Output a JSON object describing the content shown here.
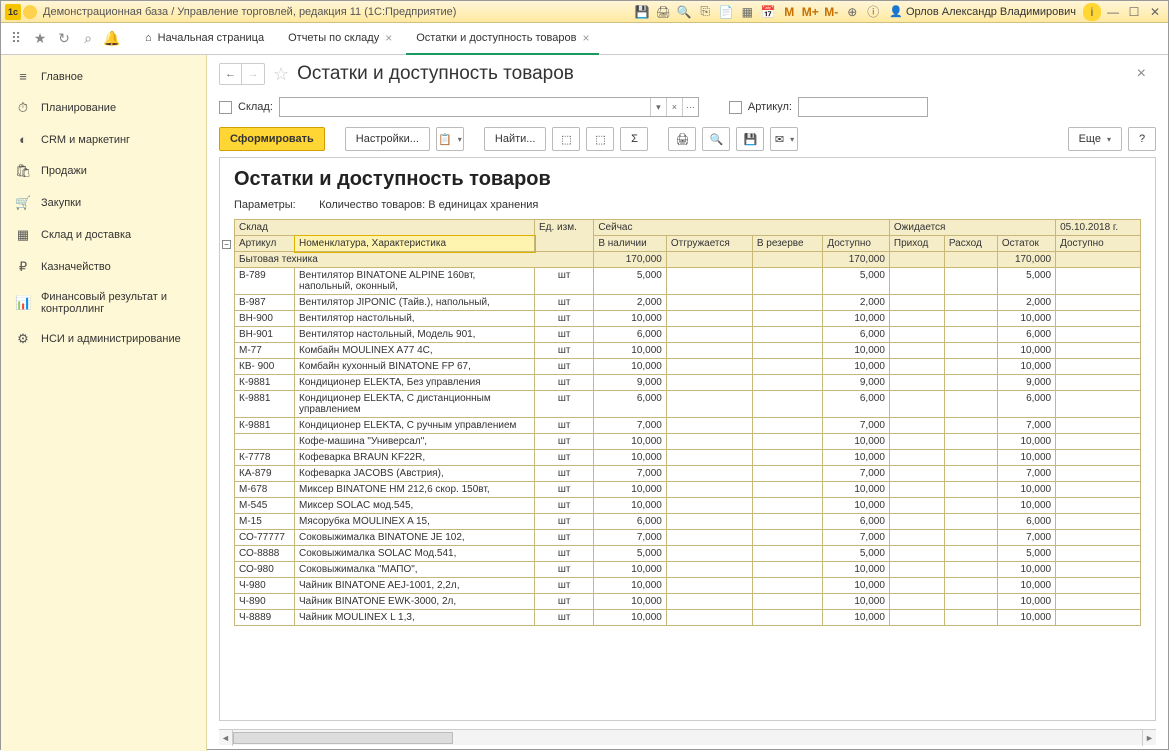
{
  "titlebar": {
    "title": "Демонстрационная база / Управление торговлей, редакция 11  (1С:Предприятие)",
    "user": "Орлов Александр Владимирович"
  },
  "tabs": {
    "home": "Начальная страница",
    "t1": "Отчеты по складу",
    "t2": "Остатки и доступность товаров"
  },
  "sidebar": {
    "items": [
      {
        "icon": "≡",
        "label": "Главное"
      },
      {
        "icon": "⏱",
        "label": "Планирование"
      },
      {
        "icon": "◐",
        "label": "CRM и маркетинг"
      },
      {
        "icon": "🛍",
        "label": "Продажи"
      },
      {
        "icon": "🛒",
        "label": "Закупки"
      },
      {
        "icon": "▦",
        "label": "Склад и доставка"
      },
      {
        "icon": "₽",
        "label": "Казначейство"
      },
      {
        "icon": "📊",
        "label": "Финансовый результат и контроллинг"
      },
      {
        "icon": "⚙",
        "label": "НСИ и администрирование"
      }
    ]
  },
  "page": {
    "title": "Остатки и доступность товаров",
    "filters": {
      "warehouse_label": "Склад:",
      "article_label": "Артикул:"
    },
    "toolbar": {
      "form": "Сформировать",
      "settings": "Настройки...",
      "find": "Найти...",
      "more": "Еще",
      "help": "?"
    }
  },
  "report": {
    "title": "Остатки и доступность товаров",
    "params_label": "Параметры:",
    "params_value": "Количество товаров: В единицах хранения",
    "headers": {
      "warehouse": "Склад",
      "article": "Артикул",
      "nomen": "Номенклатура, Характеристика",
      "unit": "Ед. изм.",
      "now": "Сейчас",
      "stock": "В наличии",
      "ship": "Отгружается",
      "reserve": "В резерве",
      "avail": "Доступно",
      "expected": "Ожидается",
      "income": "Приход",
      "expense": "Расход",
      "balance": "Остаток",
      "date": "05.10.2018 г.",
      "avail2": "Доступно"
    },
    "group": {
      "name": "Бытовая техника",
      "stock": "170,000",
      "avail": "170,000",
      "balance": "170,000"
    },
    "rows": [
      {
        "art": "В-789",
        "name": "Вентилятор BINATONE ALPINE 160вт, напольный, оконный,",
        "u": "шт",
        "v": "5,000"
      },
      {
        "art": "В-987",
        "name": "Вентилятор JIPONIC (Тайв.), напольный,",
        "u": "шт",
        "v": "2,000"
      },
      {
        "art": "ВН-900",
        "name": "Вентилятор настольный,",
        "u": "шт",
        "v": "10,000"
      },
      {
        "art": "ВН-901",
        "name": "Вентилятор настольный, Модель 901,",
        "u": "шт",
        "v": "6,000"
      },
      {
        "art": "М-77",
        "name": "Комбайн MOULINEX  A77 4C,",
        "u": "шт",
        "v": "10,000"
      },
      {
        "art": "КВ- 900",
        "name": "Комбайн кухонный BINATONE FP 67,",
        "u": "шт",
        "v": "10,000"
      },
      {
        "art": "К-9881",
        "name": "Кондиционер ELEKTA, Без управления",
        "u": "шт",
        "v": "9,000"
      },
      {
        "art": "К-9881",
        "name": "Кондиционер ELEKTA, С дистанционным управлением",
        "u": "шт",
        "v": "6,000"
      },
      {
        "art": "К-9881",
        "name": "Кондиционер ELEKTA, С ручным управлением",
        "u": "шт",
        "v": "7,000"
      },
      {
        "art": "",
        "name": "Кофе-машина \"Универсал\",",
        "u": "шт",
        "v": "10,000"
      },
      {
        "art": "К-7778",
        "name": "Кофеварка BRAUN KF22R,",
        "u": "шт",
        "v": "10,000"
      },
      {
        "art": "КА-879",
        "name": "Кофеварка JACOBS (Австрия),",
        "u": "шт",
        "v": "7,000"
      },
      {
        "art": "М-678",
        "name": "Миксер BINATONE HM 212,6 скор. 150вт,",
        "u": "шт",
        "v": "10,000"
      },
      {
        "art": "М-545",
        "name": "Миксер SOLAC мод.545,",
        "u": "шт",
        "v": "10,000"
      },
      {
        "art": "М-15",
        "name": "Мясорубка MOULINEX  A 15,",
        "u": "шт",
        "v": "6,000"
      },
      {
        "art": "СО-77777",
        "name": "Соковыжималка  BINATONE JE 102,",
        "u": "шт",
        "v": "7,000"
      },
      {
        "art": "СО-8888",
        "name": "Соковыжималка SOLAC  Мод.541,",
        "u": "шт",
        "v": "5,000"
      },
      {
        "art": "СО-980",
        "name": "Соковыжималка \"МАПО\",",
        "u": "шт",
        "v": "10,000"
      },
      {
        "art": "Ч-980",
        "name": "Чайник BINATONE  AEJ-1001,  2,2л,",
        "u": "шт",
        "v": "10,000"
      },
      {
        "art": "Ч-890",
        "name": "Чайник BINATONE  EWK-3000, 2л,",
        "u": "шт",
        "v": "10,000"
      },
      {
        "art": "Ч-8889",
        "name": "Чайник MOULINEX L 1,3,",
        "u": "шт",
        "v": "10,000"
      }
    ]
  }
}
